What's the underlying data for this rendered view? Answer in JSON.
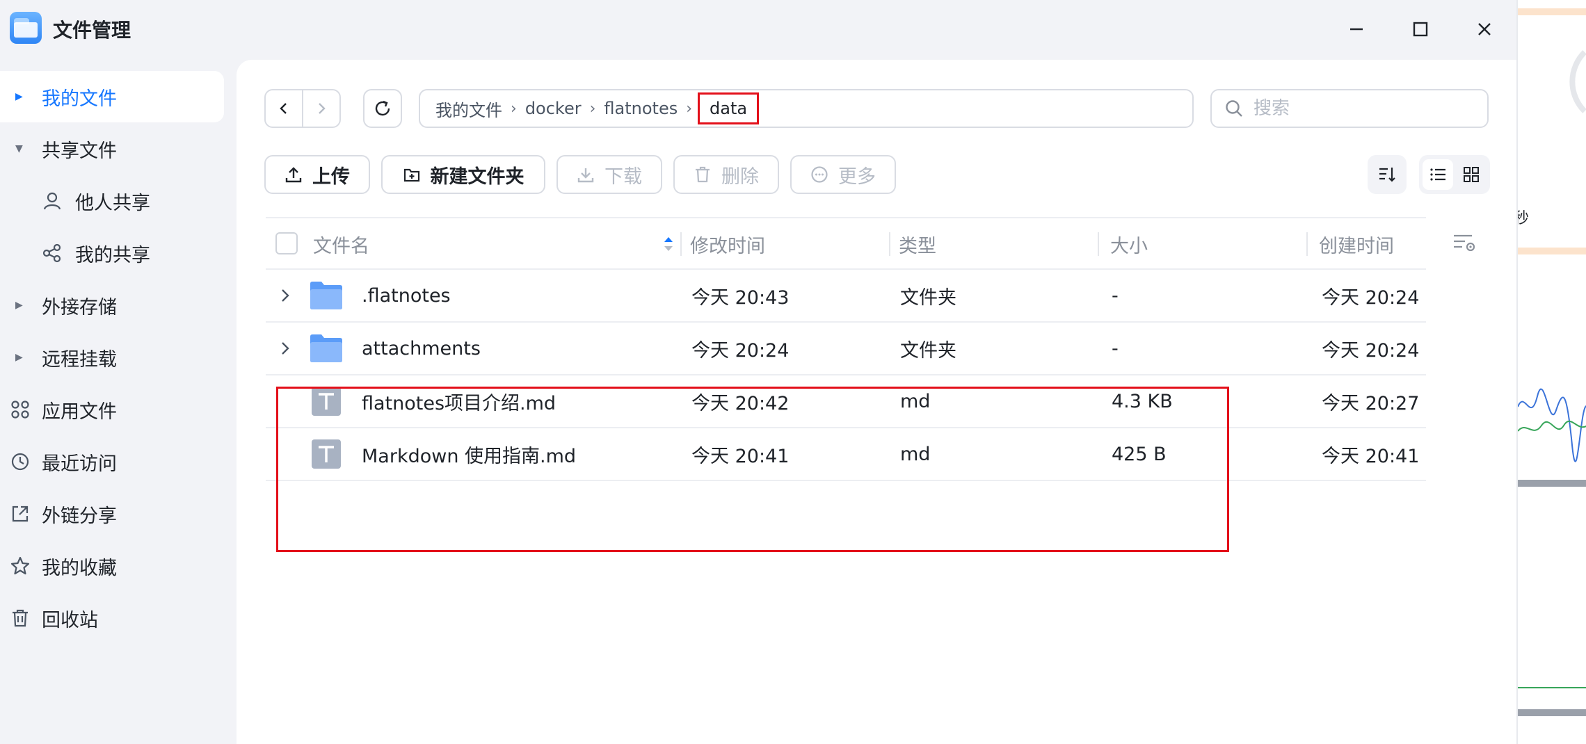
{
  "window": {
    "title": "文件管理",
    "controls": {
      "minimize": "minimize-icon",
      "maximize": "maximize-icon",
      "close": "close-icon"
    }
  },
  "sidebar": {
    "items": [
      {
        "label": "我的文件",
        "active": true,
        "caret": "right"
      },
      {
        "label": "共享文件",
        "caret": "down"
      },
      {
        "label": "他人共享",
        "icon": "user-icon",
        "sub": true
      },
      {
        "label": "我的共享",
        "icon": "share-icon",
        "sub": true
      },
      {
        "label": "外接存储",
        "caret": "right"
      },
      {
        "label": "远程挂载",
        "caret": "right"
      },
      {
        "label": "应用文件",
        "icon": "apps-icon"
      },
      {
        "label": "最近访问",
        "icon": "clock-icon"
      },
      {
        "label": "外链分享",
        "icon": "external-link-icon"
      },
      {
        "label": "我的收藏",
        "icon": "star-icon"
      },
      {
        "label": "回收站",
        "icon": "trash-icon"
      }
    ]
  },
  "breadcrumb": [
    "我的文件",
    "docker",
    "flatnotes",
    "data"
  ],
  "search": {
    "placeholder": "搜索"
  },
  "toolbar": {
    "upload": "上传",
    "new_folder": "新建文件夹",
    "download": "下载",
    "delete": "删除",
    "more": "更多"
  },
  "table": {
    "columns": {
      "name": "文件名",
      "modified": "修改时间",
      "type": "类型",
      "size": "大小",
      "created": "创建时间"
    },
    "rows": [
      {
        "name": ".flatnotes",
        "modified": "今天 20:43",
        "type": "文件夹",
        "size": "-",
        "created": "今天 20:24",
        "kind": "folder"
      },
      {
        "name": "attachments",
        "modified": "今天 20:24",
        "type": "文件夹",
        "size": "-",
        "created": "今天 20:24",
        "kind": "folder"
      },
      {
        "name": "flatnotes项目介绍.md",
        "modified": "今天 20:42",
        "type": "md",
        "size": "4.3 KB",
        "created": "今天 20:27",
        "kind": "text-file"
      },
      {
        "name": "Markdown 使用指南.md",
        "modified": "今天 20:41",
        "type": "md",
        "size": "425 B",
        "created": "今天 20:41",
        "kind": "text-file"
      }
    ]
  },
  "background_fragment": {
    "text": "秒"
  },
  "colors": {
    "accent": "#1677ff",
    "highlight": "#e3101a",
    "folder": "#5b9cf8",
    "file": "#a8b2c2"
  }
}
